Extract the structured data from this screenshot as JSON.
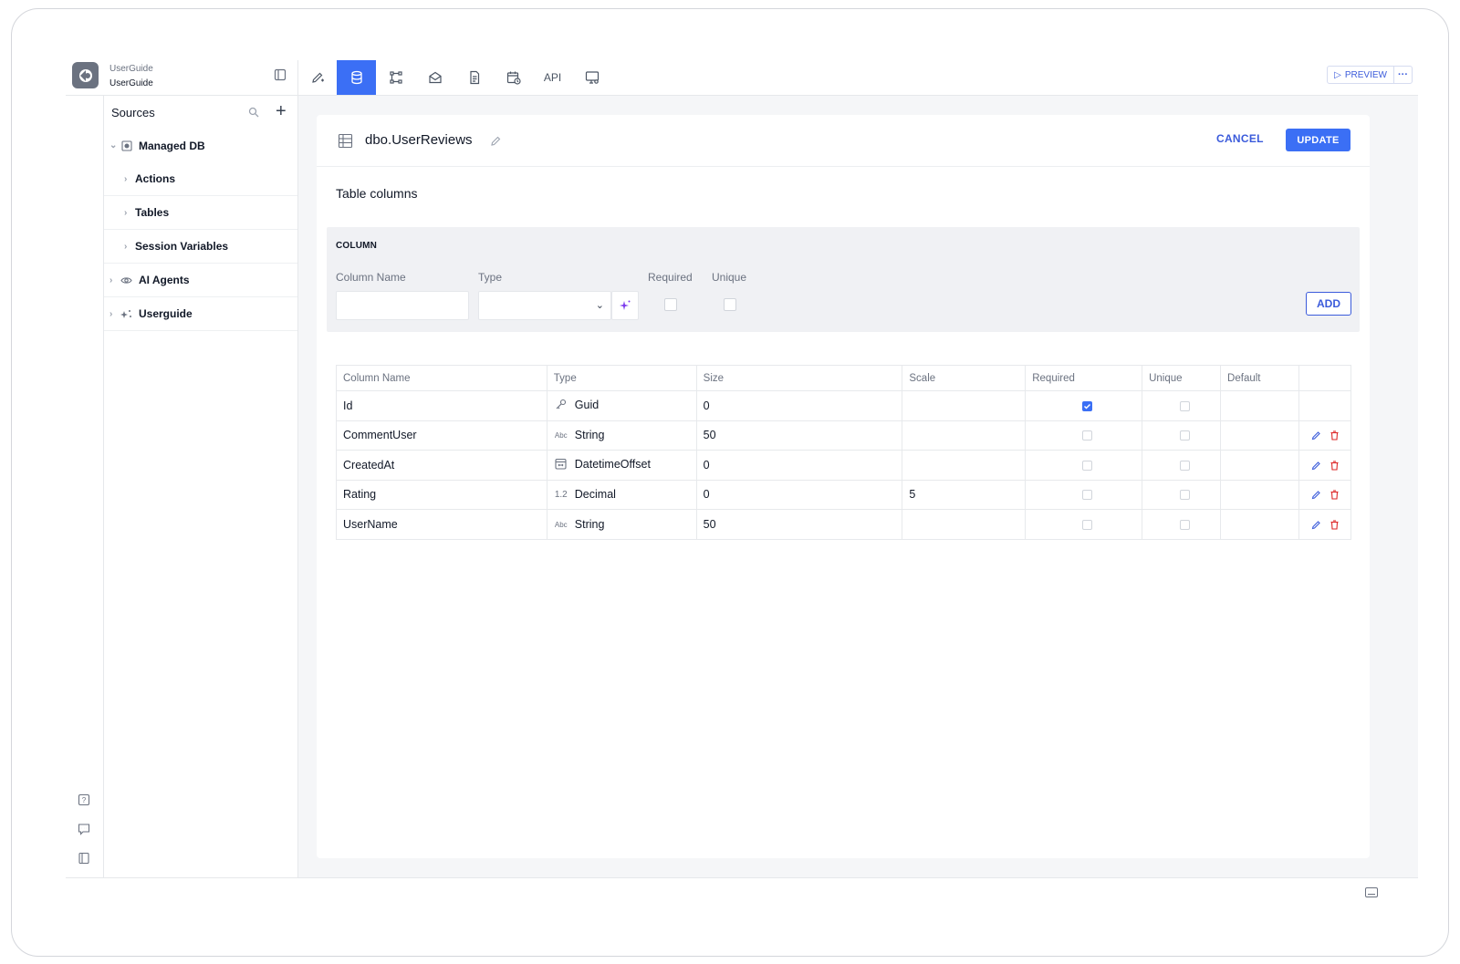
{
  "app": {
    "org": "UserGuide",
    "project": "UserGuide",
    "preview_label": "PREVIEW",
    "more_label": "···"
  },
  "toolbar": {
    "api_label": "API",
    "active_tool": "database",
    "accent": "#3b6ff5"
  },
  "sidebar": {
    "title": "Sources",
    "items": [
      {
        "label": "Managed DB",
        "icon": "database-icon",
        "level": 0,
        "expanded": true
      },
      {
        "label": "Actions",
        "level": 1
      },
      {
        "label": "Tables",
        "level": 1
      },
      {
        "label": "Session Variables",
        "level": 1
      },
      {
        "label": "AI Agents",
        "icon": "eye-icon",
        "level": 0
      },
      {
        "label": "Userguide",
        "icon": "sparkle-icon",
        "level": 0
      }
    ]
  },
  "editor": {
    "table_name": "dbo.UserReviews",
    "cancel_label": "CANCEL",
    "update_label": "UPDATE",
    "section_title": "Table columns"
  },
  "form": {
    "title": "COLUMN",
    "column_name_label": "Column Name",
    "type_label": "Type",
    "required_label": "Required",
    "unique_label": "Unique",
    "add_label": "ADD",
    "column_name_value": "",
    "type_value": ""
  },
  "grid": {
    "headers": [
      "Column Name",
      "Type",
      "Size",
      "Scale",
      "Required",
      "Unique",
      "Default",
      ""
    ],
    "rows": [
      {
        "name": "Id",
        "type_icon": "key-icon",
        "type": "Guid",
        "size": "0",
        "scale": "",
        "required": true,
        "unique": false,
        "default": "",
        "editable": false
      },
      {
        "name": "CommentUser",
        "type_icon": "abc-icon",
        "type": "String",
        "size": "50",
        "scale": "",
        "required": false,
        "unique": false,
        "default": "",
        "editable": true
      },
      {
        "name": "CreatedAt",
        "type_icon": "calendar-icon",
        "type": "DatetimeOffset",
        "size": "0",
        "scale": "",
        "required": false,
        "unique": false,
        "default": "",
        "editable": true
      },
      {
        "name": "Rating",
        "type_icon": "decimal-icon",
        "type": "Decimal",
        "size": "0",
        "scale": "5",
        "required": false,
        "unique": false,
        "default": "",
        "editable": true
      },
      {
        "name": "UserName",
        "type_icon": "abc-icon",
        "type": "String",
        "size": "50",
        "scale": "",
        "required": false,
        "unique": false,
        "default": "",
        "editable": true
      }
    ]
  }
}
